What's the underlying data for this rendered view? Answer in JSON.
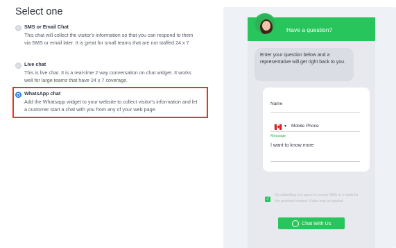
{
  "page": {
    "title": "Select one"
  },
  "options": [
    {
      "label": "SMS or Email Chat",
      "description": "This chat will collect the visitor's information so that you can respond to them via SMS or email later. It is great for small teams that are not staffed 24 x 7",
      "selected": false
    },
    {
      "label": "Live chat",
      "description": "This is live chat. It is a real-time 2 way conversation on chat widget. It works well for large teams that have 24 x 7 coverage.",
      "selected": false
    },
    {
      "label": "WhatsApp chat",
      "description": "Add the Whatsapp widget to your website to collect visitor's information and let a customer start a chat with you from any of your web page.",
      "selected": true
    }
  ],
  "widget": {
    "header": "Have a question?",
    "bubble": "Enter your question below and a representative will get right back to you.",
    "name_label": "Name",
    "phone_placeholder": "Mobile Phone",
    "message_label": "Message",
    "message_value": "I want to know more",
    "consent": "By submitting you agree to receive SMS or e-mails for the provided channel. Rates may be applied.",
    "button_label": "Chat With Us",
    "accent": "#28c55c",
    "highlight": "#e3361b",
    "icons": {
      "avatar": "avatar-icon",
      "flag": "canada-flag-icon",
      "whatsapp": "whatsapp-icon",
      "check": "checkbox-checked-icon"
    }
  }
}
